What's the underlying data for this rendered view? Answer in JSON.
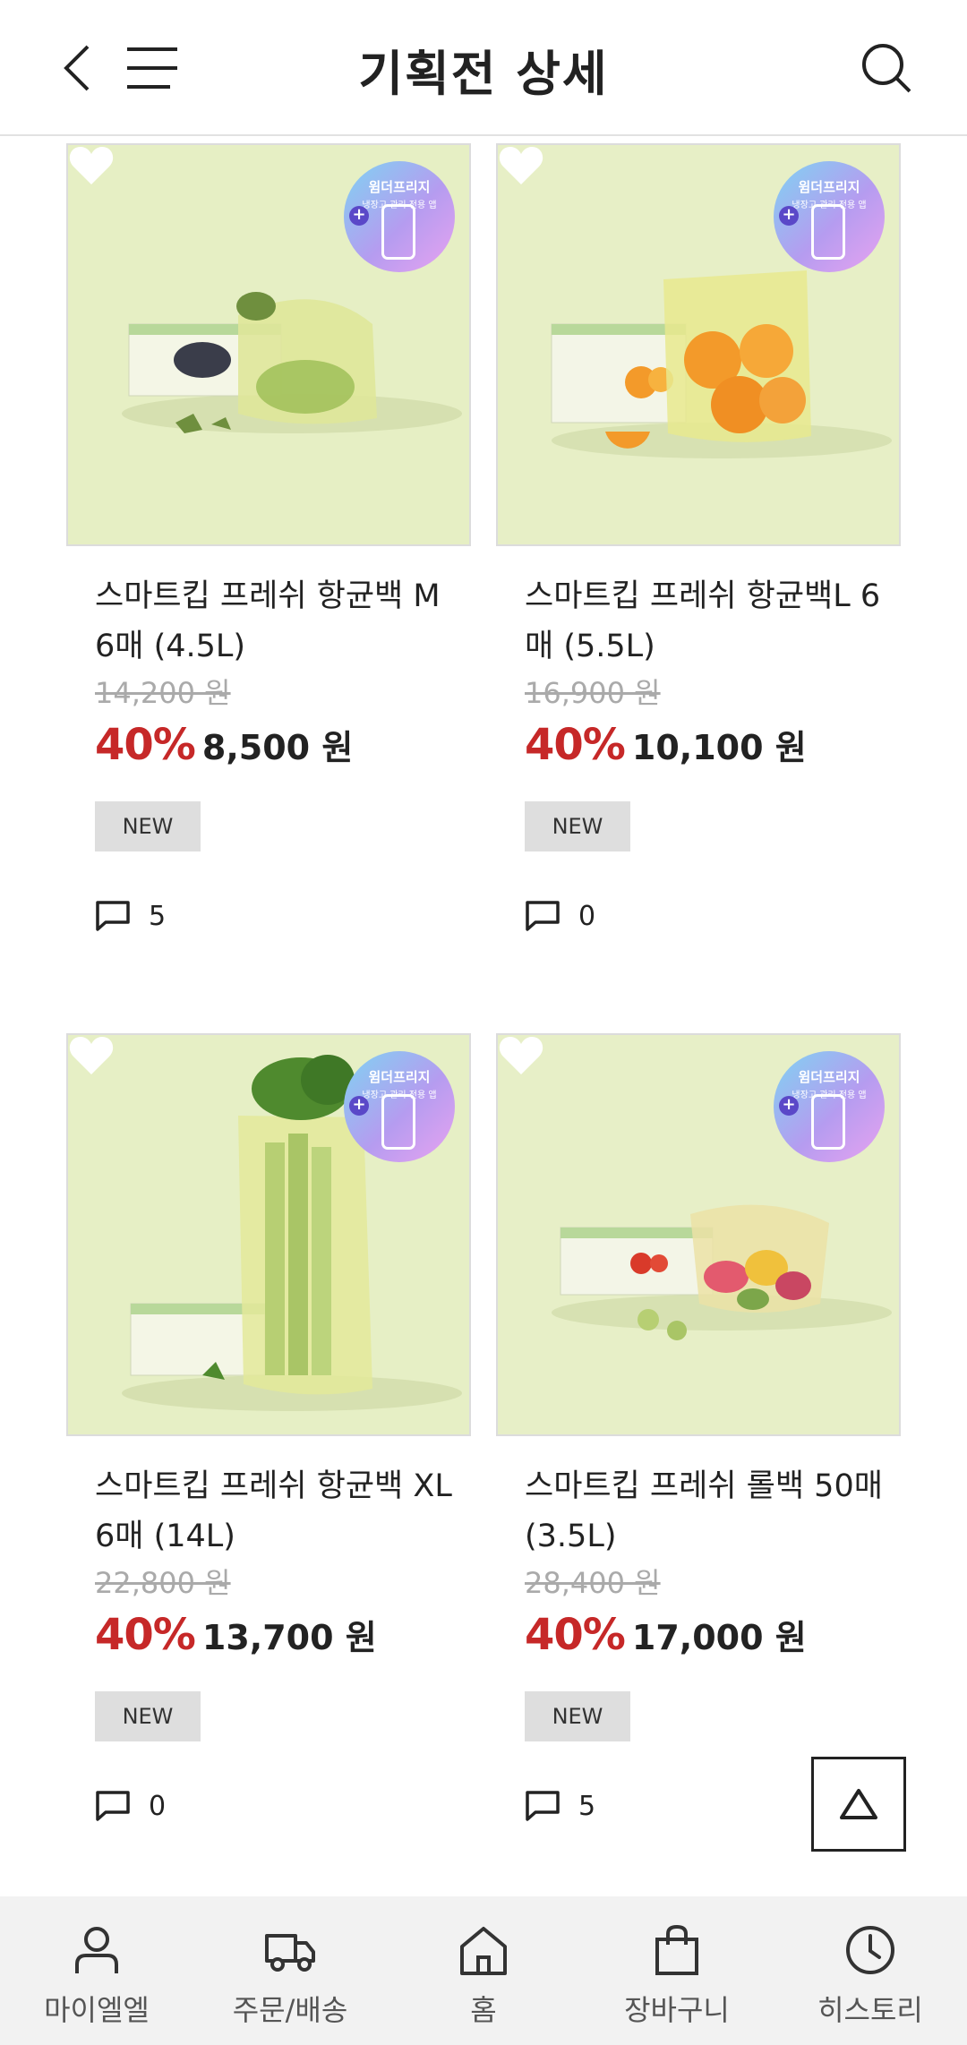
{
  "header": {
    "title": "기획전 상세",
    "back_icon": "chevron-left-icon",
    "menu_icon": "hamburger-menu-icon",
    "search_icon": "search-icon"
  },
  "badge": {
    "title": "윔더프리지",
    "subtitle": "냉장고 관리 전용 앱"
  },
  "products": [
    {
      "name": "스마트킵 프레쉬 항균백 M 6매 (4.5L)",
      "original_price": "14,200 원",
      "discount": "40%",
      "price": "8,500 원",
      "tag": "NEW",
      "comment_count": "5"
    },
    {
      "name": "스마트킵 프레쉬 항균백L 6매 (5.5L)",
      "original_price": "16,900 원",
      "discount": "40%",
      "price": "10,100 원",
      "tag": "NEW",
      "comment_count": "0"
    },
    {
      "name": "스마트킵 프레쉬 항균백 XL 6매 (14L)",
      "original_price": "22,800 원",
      "discount": "40%",
      "price": "13,700 원",
      "tag": "NEW",
      "comment_count": "0"
    },
    {
      "name": "스마트킵 프레쉬 롤백 50매 (3.5L)",
      "original_price": "28,400 원",
      "discount": "40%",
      "price": "17,000 원",
      "tag": "NEW",
      "comment_count": "5"
    }
  ],
  "bottom_nav": [
    {
      "label": "마이엘엘",
      "icon": "person-icon"
    },
    {
      "label": "주문/배송",
      "icon": "truck-icon"
    },
    {
      "label": "홈",
      "icon": "home-icon"
    },
    {
      "label": "장바구니",
      "icon": "shopping-bag-icon"
    },
    {
      "label": "히스토리",
      "icon": "clock-icon"
    }
  ],
  "colors": {
    "discount": "#c62828",
    "image_bg": "#e8f0c5",
    "nav_bg": "#f2f2f2"
  }
}
